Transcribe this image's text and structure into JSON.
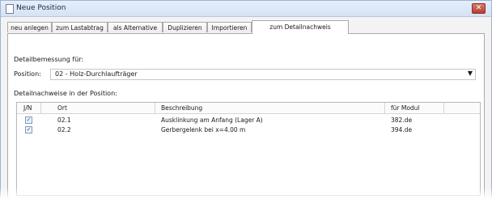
{
  "window": {
    "title": "Neue Position",
    "close_glyph": "✕"
  },
  "tabs": [
    {
      "label": "neu anlegen"
    },
    {
      "label": "zum Lastabtrag"
    },
    {
      "label": "als Alternative"
    },
    {
      "label": "Duplizieren"
    },
    {
      "label": "Importieren"
    },
    {
      "label": "zum Detailnachweis"
    }
  ],
  "form": {
    "section_label": "Detailbemessung für:",
    "position_label": "Position:",
    "position_value": "02 - Holz-Durchlaufträger",
    "list_label": "Detailnachweise in der Position:"
  },
  "table": {
    "headers": {
      "jn": "J/N",
      "ort": "Ort",
      "beschreibung": "Beschreibung",
      "modul": "für Modul"
    },
    "rows": [
      {
        "checked": true,
        "ort": "02.1",
        "beschreibung": "Ausklinkung am Anfang (Lager A)",
        "modul": "382.de"
      },
      {
        "checked": true,
        "ort": "02.2",
        "beschreibung": "Gerbergelenk bei x=4.00 m",
        "modul": "394.de"
      }
    ]
  },
  "colors": {
    "accent": "#9fb4cf",
    "close": "#b8402f"
  }
}
